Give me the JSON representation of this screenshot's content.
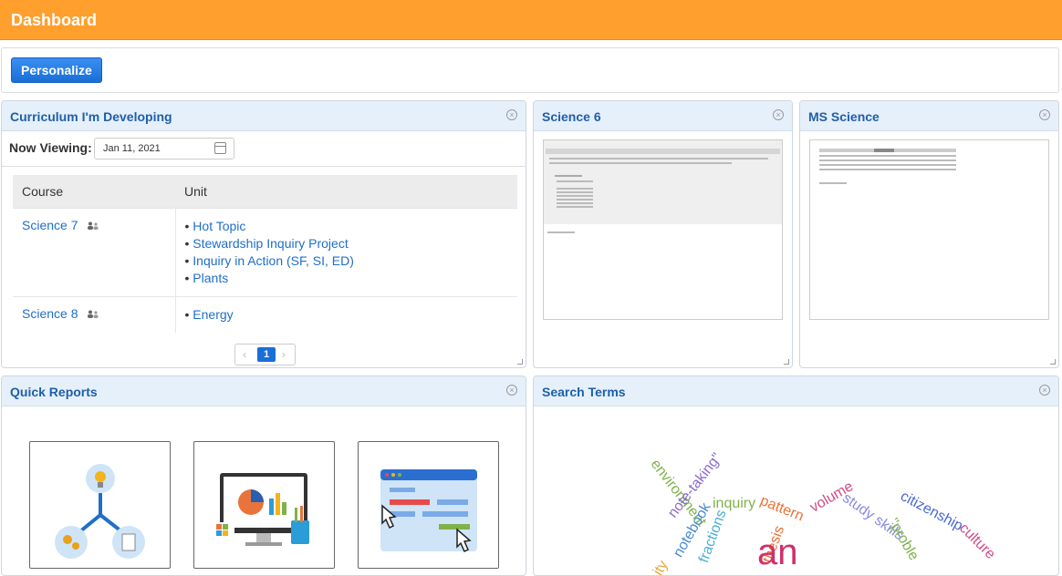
{
  "header": {
    "title": "Dashboard"
  },
  "toolbar": {
    "personalize_label": "Personalize"
  },
  "curriculum": {
    "title": "Curriculum I'm Developing",
    "now_viewing_label": "Now Viewing:",
    "date_value": "Jan 11, 2021",
    "columns": [
      "Course",
      "Unit"
    ],
    "rows": [
      {
        "course": "Science 7",
        "units": [
          "Hot Topic",
          "Stewardship Inquiry Project",
          "Inquiry in Action (SF, SI, ED)",
          "Plants"
        ]
      },
      {
        "course": "Science 8",
        "units": [
          "Energy"
        ]
      }
    ],
    "pager": {
      "prev": "‹",
      "current": "1",
      "next": "›"
    }
  },
  "science6": {
    "title": "Science 6"
  },
  "msscience": {
    "title": "MS Science"
  },
  "quick_reports": {
    "title": "Quick Reports"
  },
  "search_terms": {
    "title": "Search Terms",
    "words": [
      {
        "text": "environment",
        "color": "#7fb24a"
      },
      {
        "text": "note-taking\"",
        "color": "#8a6ad0"
      },
      {
        "text": "inquiry",
        "color": "#7fb24a"
      },
      {
        "text": "pattern",
        "color": "#e8743b"
      },
      {
        "text": "volume",
        "color": "#d04a8a"
      },
      {
        "text": "study skills",
        "color": "#8a8ae0"
      },
      {
        "text": "citizenship",
        "color": "#4a6ad0"
      },
      {
        "text": "culture",
        "color": "#d04a8a"
      },
      {
        "text": "\"proble",
        "color": "#7fb24a"
      },
      {
        "text": "notebook",
        "color": "#4a8ad0"
      },
      {
        "text": "fractions",
        "color": "#4ab0d0"
      },
      {
        "text": "thesis",
        "color": "#e8743b"
      },
      {
        "text": "ity",
        "color": "#e8a83b"
      },
      {
        "text": "an",
        "color": "#d0306a"
      }
    ]
  },
  "colors": {
    "header": "#ff9f2e",
    "panel_head": "#e6f0fb",
    "link": "#1f6fc8",
    "primary_button": "#1a6ed8"
  }
}
